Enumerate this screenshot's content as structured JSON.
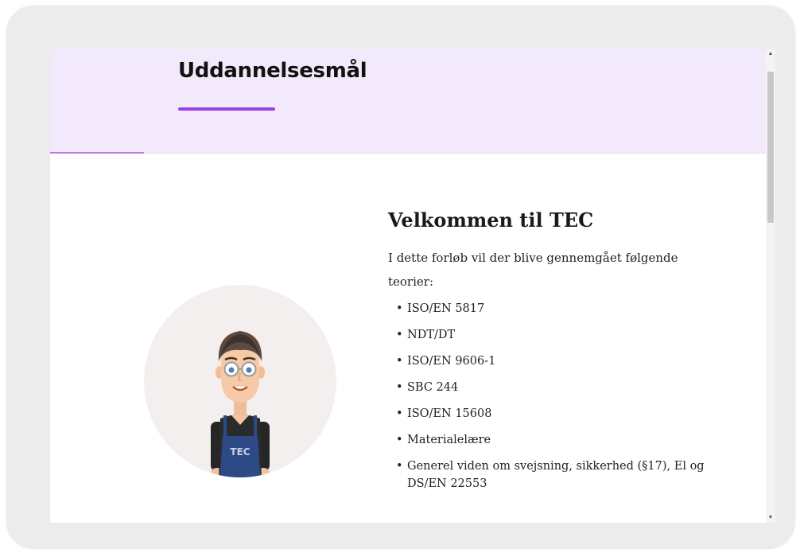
{
  "header": {
    "title": "Uddannelsesmål"
  },
  "main": {
    "heading": "Velkommen til TEC",
    "intro": "I dette forløb vil der blive gennemgået følgende teorier:",
    "topics": [
      "ISO/EN 5817",
      "NDT/DT",
      "ISO/EN 9606-1",
      "SBC 244",
      "ISO/EN 15608",
      "Materialelære",
      "Generel viden om svejsning, sikkerhed (§17), El og DS/EN 22553"
    ]
  },
  "avatar": {
    "apron_text": "TEC",
    "icon": "person-illustration-icon"
  },
  "colors": {
    "accent": "#9b3fe6",
    "header_bg": "#f3e9fc"
  }
}
